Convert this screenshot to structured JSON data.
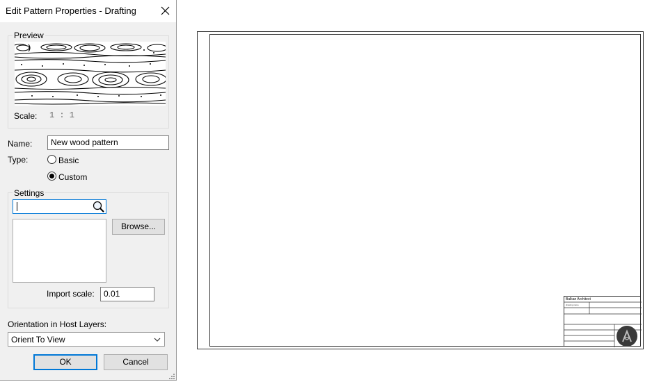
{
  "dialog": {
    "title": "Edit Pattern Properties - Drafting",
    "preview": {
      "label": "Preview",
      "scale_label": "Scale:",
      "scale_value": "1 : 1"
    },
    "name_label": "Name:",
    "name_value": "New wood pattern",
    "type_label": "Type:",
    "type_options": [
      {
        "label": "Basic",
        "checked": false
      },
      {
        "label": "Custom",
        "checked": true
      }
    ],
    "settings": {
      "label": "Settings",
      "search_value": "",
      "browse_label": "Browse...",
      "import_scale_label": "Import scale:",
      "import_scale_value": "0.01"
    },
    "orientation_label": "Orientation in Host Layers:",
    "orientation_value": "Orient To View",
    "ok_label": "OK",
    "cancel_label": "Cancel"
  },
  "title_block": {
    "company": "Balkan Architect",
    "drawing_name": "drawing name"
  },
  "colors": {
    "accent": "#0078d7",
    "dialog_bg": "#f0f0f0",
    "logo_bg": "#3a3a3a"
  }
}
